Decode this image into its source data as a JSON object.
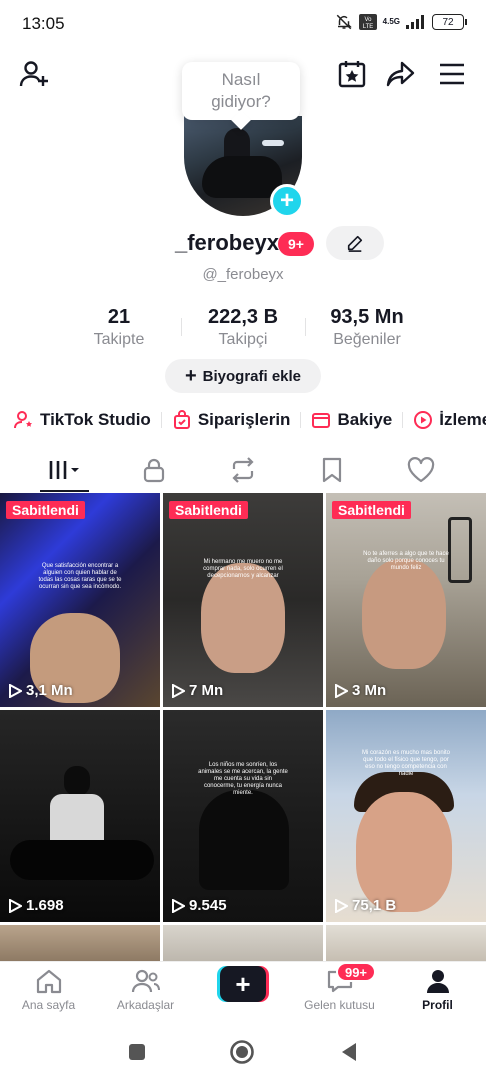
{
  "status_bar": {
    "time": "13:05",
    "network": "4.5G",
    "battery": "72"
  },
  "header": {
    "icons": [
      "add-friend-icon",
      "calendar-star-icon",
      "share-icon",
      "menu-icon"
    ]
  },
  "bubble": {
    "line1": "Nasıl",
    "line2": "gidiyor?"
  },
  "profile": {
    "username": "_ferobeyx",
    "notif_badge": "9+",
    "handle": "@_ferobeyx"
  },
  "stats": {
    "following": {
      "value": "21",
      "label": "Takipte"
    },
    "followers": {
      "value": "222,3 B",
      "label": "Takipçi"
    },
    "likes": {
      "value": "93,5 Mn",
      "label": "Beğeniler"
    }
  },
  "bio_button": "Biyografi ekle",
  "shortcuts": [
    {
      "label": "TikTok Studio",
      "icon": "studio-person-icon"
    },
    {
      "label": "Siparişlerin",
      "icon": "shopping-bag-icon"
    },
    {
      "label": "Bakiye",
      "icon": "wallet-icon"
    },
    {
      "label": "İzleme",
      "icon": "play-circle-icon"
    }
  ],
  "tabs": [
    "videos-grid-icon",
    "lock-icon",
    "repost-icon",
    "bookmark-icon",
    "heart-icon"
  ],
  "videos": [
    {
      "pinned": "Sabitlendi",
      "views": "3,1 Mn",
      "caption": "Que satisfacción encontrar a alguien con quien hablar de todas las cosas raras que se te ocurran sin que sea incómodo."
    },
    {
      "pinned": "Sabitlendi",
      "views": "7 Mn",
      "caption": "Mi hermano me muero no me comprar nada, solo ocurren el decepcionarnos y alcanzar"
    },
    {
      "pinned": "Sabitlendi",
      "views": "3 Mn",
      "caption": "No te aferres a algo que te hace daño solo porque conoces tu mundo feliz"
    },
    {
      "pinned": "",
      "views": "1.698",
      "caption": ""
    },
    {
      "pinned": "",
      "views": "9.545",
      "caption": "Los niños me sonríen, los animales se me acercan, la gente me cuenta su vida sin conocerme, tu energía nunca miente."
    },
    {
      "pinned": "",
      "views": "75,1 B",
      "caption": "Mi corazón es mucho mas bonito que todo el físico que tengo, por eso no tengo competencia con nadie"
    }
  ],
  "bottom_nav": [
    {
      "label": "Ana sayfa",
      "icon": "home-icon"
    },
    {
      "label": "Arkadaşlar",
      "icon": "friends-icon"
    },
    {
      "label": "",
      "icon": "create-plus-icon"
    },
    {
      "label": "Gelen kutusu",
      "icon": "inbox-icon"
    },
    {
      "label": "Profil",
      "icon": "profile-icon"
    }
  ],
  "inbox_badge": "99+",
  "colors": {
    "accent_red": "#fe2c55",
    "accent_cyan": "#20d5ec",
    "text_primary": "#161823",
    "text_secondary": "#8a8b91"
  }
}
